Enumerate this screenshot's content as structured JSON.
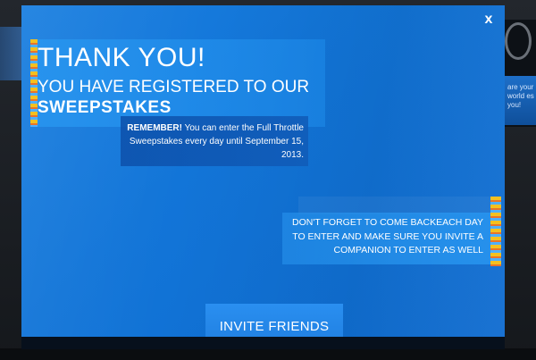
{
  "background": {
    "side_text": "are your world es you!"
  },
  "modal": {
    "close_label": "x",
    "title": "THANK YOU!",
    "subtitle_line1": "YOU HAVE REGISTERED TO OUR",
    "subtitle_line2": "SWEEPSTAKES",
    "remember": {
      "strong": "REMEMBER!",
      "text": "You can enter the Full Throttle Sweepstakes every day until September 15, 2013."
    },
    "reminder_text": "DON'T FORGET TO COME BACKEACH DAY TO ENTER AND MAKE SURE YOU INVITE A COMPANION TO ENTER AS WELL",
    "invite_button_label": "INVITE FRIENDS"
  },
  "colors": {
    "modal_blue": "#1275d8",
    "accent_yellow": "#f4c020",
    "text_white": "#ffffff"
  }
}
